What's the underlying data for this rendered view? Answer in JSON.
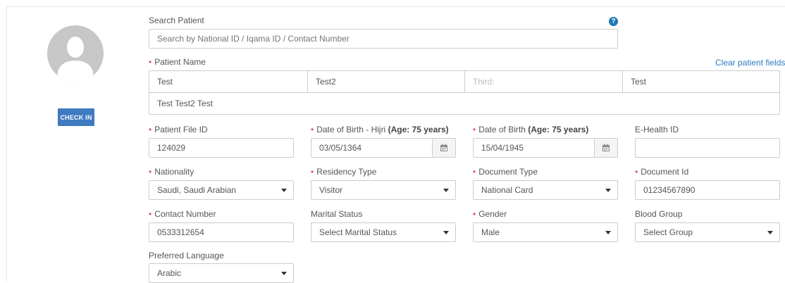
{
  "help_glyph": "?",
  "checkin_label": "CHECK IN",
  "search": {
    "label": "Search Patient",
    "placeholder": "Search by National ID / Iqama ID / Contact Number"
  },
  "name": {
    "label": "Patient Name",
    "clear_link": "Clear patient fields",
    "first": "Test",
    "second": "Test2",
    "third_placeholder": "Third:",
    "last": "Test",
    "full": "Test Test2 Test"
  },
  "fields": {
    "file_id": {
      "label": "Patient File ID",
      "value": "124029"
    },
    "dob_hijri": {
      "label": "Date of Birth - Hijri",
      "age": "(Age: 75 years)",
      "value": "03/05/1364"
    },
    "dob": {
      "label": "Date of Birth",
      "age": "(Age: 75 years)",
      "value": "15/04/1945"
    },
    "ehealth": {
      "label": "E-Health ID",
      "value": ""
    },
    "nationality": {
      "label": "Nationality",
      "value": "Saudi, Saudi Arabian"
    },
    "residency": {
      "label": "Residency Type",
      "value": "Visitor"
    },
    "doc_type": {
      "label": "Document Type",
      "value": "National Card"
    },
    "doc_id": {
      "label": "Document Id",
      "value": "01234567890"
    },
    "contact": {
      "label": "Contact Number",
      "value": "0533312654"
    },
    "marital": {
      "label": "Marital Status",
      "value": "Select Marital Status"
    },
    "gender": {
      "label": "Gender",
      "value": "Male"
    },
    "blood": {
      "label": "Blood Group",
      "value": "Select Group"
    },
    "language": {
      "label": "Preferred Language",
      "value": "Arabic"
    }
  },
  "colors": {
    "required": "#d9534f",
    "accent": "#3f7ac0",
    "link": "#2a7bbf",
    "help": "#1f78b4"
  }
}
